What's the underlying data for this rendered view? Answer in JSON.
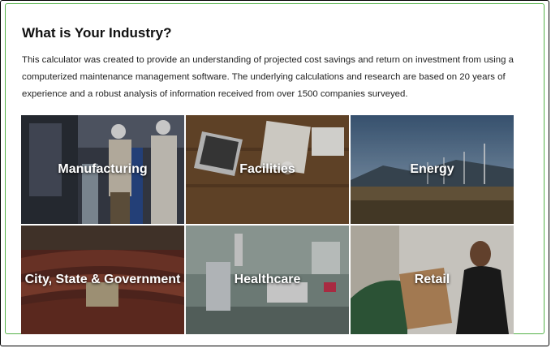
{
  "heading": "What is Your Industry?",
  "description": "This calculator was created to provide an understanding of projected cost savings and return on investment from using a computerized maintenance management software. The underlying calculations and research are based on 20 years of experience and a robust analysis of information received from over 1500 companies surveyed.",
  "industries": [
    {
      "label": "Manufacturing"
    },
    {
      "label": "Facilities"
    },
    {
      "label": "Energy"
    },
    {
      "label": "City, State & Government"
    },
    {
      "label": "Healthcare"
    },
    {
      "label": "Retail"
    }
  ],
  "colors": {
    "frame_border": "#56b24a"
  }
}
